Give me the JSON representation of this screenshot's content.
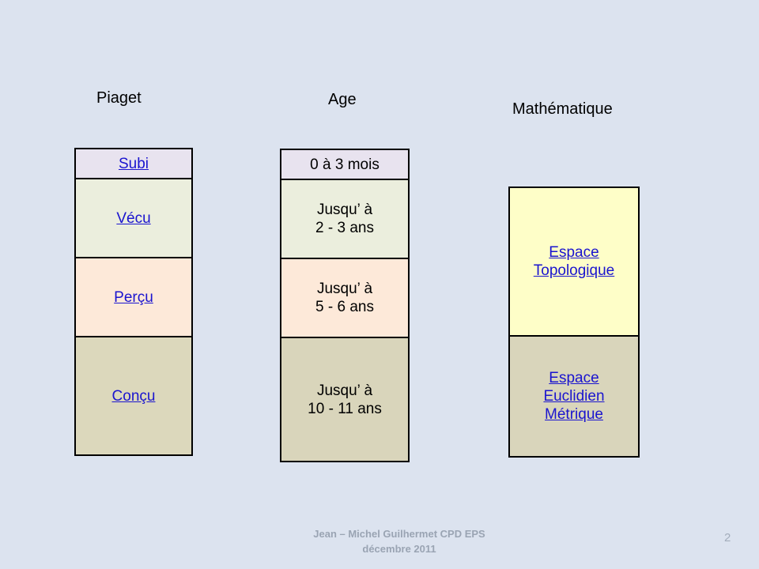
{
  "slide": {
    "background_color": "#dce3ef",
    "page_number": "2",
    "footer": "Jean – Michel Guilhermet CPD EPS\ndécembre 2011"
  },
  "headings": {
    "piaget": "Piaget",
    "age": "Age",
    "mathematique": "Mathématique"
  },
  "columns": {
    "piaget": {
      "heading": "Piaget",
      "cells": [
        {
          "label": "Subi",
          "color": "#e8e3ef",
          "linked": true
        },
        {
          "label": "Vécu",
          "color": "#ebeedd",
          "linked": true
        },
        {
          "label": "Perçu",
          "color": "#fde9d9",
          "linked": true
        },
        {
          "label": "Conçu",
          "color": "#dcd8bc",
          "linked": true
        }
      ]
    },
    "age": {
      "heading": "Age",
      "cells": [
        {
          "label": "0 à 3 mois",
          "color": "#e8e3ef",
          "linked": false
        },
        {
          "label": "Jusqu’ à\n2 - 3 ans",
          "color": "#ebeedd",
          "linked": false
        },
        {
          "label": "Jusqu’ à\n5 - 6 ans",
          "color": "#fde9d9",
          "linked": false
        },
        {
          "label": "Jusqu’ à\n10 - 11 ans",
          "color": "#d9d5bb",
          "linked": false
        }
      ]
    },
    "mathematique": {
      "heading": "Mathématique",
      "cells": [
        {
          "label": "Espace\nTopologique",
          "color": "#fefec8",
          "linked": true
        },
        {
          "label": "Espace\nEuclidien\nMétrique",
          "color": "#d9d5bb",
          "linked": true
        }
      ]
    }
  },
  "colors": {
    "background": "#dce3ef",
    "border": "#000000",
    "link_text": "#1a14cf",
    "body_text": "#000000",
    "footer_text": "#9aa4b3"
  }
}
